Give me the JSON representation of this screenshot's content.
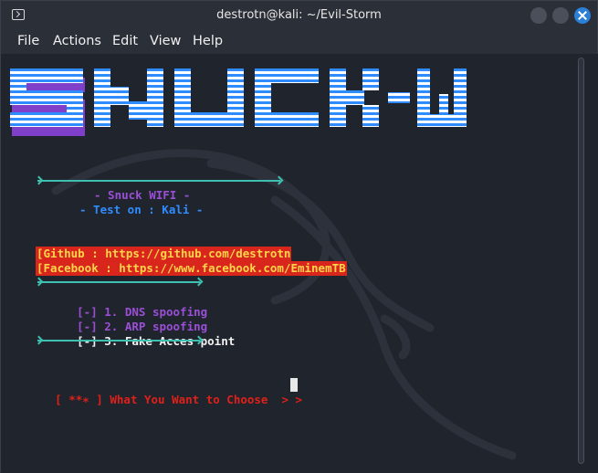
{
  "window": {
    "title": "destrotn@kali: ~/Evil-Storm"
  },
  "menu": [
    "File",
    "Actions",
    "Edit",
    "View",
    "Help"
  ],
  "banner": {
    "logo_text": "SNUCK-WI",
    "colors": {
      "blue": "#2f8cff",
      "white": "#ffffff",
      "shadow": "#8a4fd6"
    }
  },
  "header": {
    "line1": "- Snuck WIFI -",
    "line2": "- Test on : Kali -"
  },
  "links": {
    "github": "[Github : https://github.com/destrotn",
    "facebook": "[Facebook : https://www.facebook.com/EminemTB"
  },
  "options": [
    {
      "marker": "[-]",
      "label": " 1. DNS spoofing"
    },
    {
      "marker": "[-]",
      "label": " 2. ARP spoofing"
    },
    {
      "marker": "[-]",
      "label": " 3. Fake Acces point"
    }
  ],
  "prompt": {
    "prefix": "[ **∗ ]",
    "text": " What You Want to Choose  > >"
  },
  "colors": {
    "background": "#20242c",
    "accent_teal": "#3ec0b0",
    "purple": "#9a4fd6",
    "blue": "#2f8cff",
    "red": "#e0201a"
  }
}
